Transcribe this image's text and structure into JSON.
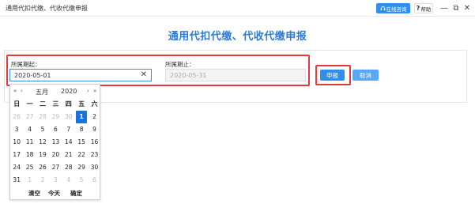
{
  "window": {
    "title": "通用代扣代缴、代收代缴申报",
    "online_label": "在线咨询",
    "help_label": "帮助",
    "minimize": "—",
    "restore": "⧉",
    "close": "✕"
  },
  "page": {
    "heading": "通用代扣代缴、代收代缴申报"
  },
  "form": {
    "start_label": "所属期起：",
    "start_value": "2020-05-01",
    "end_label": "所属期止：",
    "end_value": "2020-05-31",
    "submit_label": "申报",
    "cancel_label": "取消"
  },
  "calendar": {
    "prev_year": "«",
    "prev_month": "‹",
    "month": "五月",
    "year": "2020",
    "next_month": "›",
    "next_year": "»",
    "weekdays": [
      "日",
      "一",
      "二",
      "三",
      "四",
      "五",
      "六"
    ],
    "weeks": [
      [
        "26",
        "27",
        "28",
        "29",
        "30",
        "1",
        "2"
      ],
      [
        "3",
        "4",
        "5",
        "6",
        "7",
        "8",
        "9"
      ],
      [
        "10",
        "11",
        "12",
        "13",
        "14",
        "15",
        "16"
      ],
      [
        "17",
        "18",
        "19",
        "20",
        "21",
        "22",
        "23"
      ],
      [
        "24",
        "25",
        "26",
        "27",
        "28",
        "29",
        "30"
      ],
      [
        "31",
        "1",
        "2",
        "3",
        "4",
        "5",
        "6"
      ]
    ],
    "selected_day": "1",
    "clear_label": "清空",
    "today_label": "今天",
    "confirm_label": "确定"
  },
  "colors": {
    "accent": "#2f8ff0",
    "heading": "#2d7ad6",
    "highlight_border": "#e4393c",
    "selected_day": "#1a73d9"
  },
  "icons": {
    "online": "headset-icon",
    "help": "question-icon"
  }
}
